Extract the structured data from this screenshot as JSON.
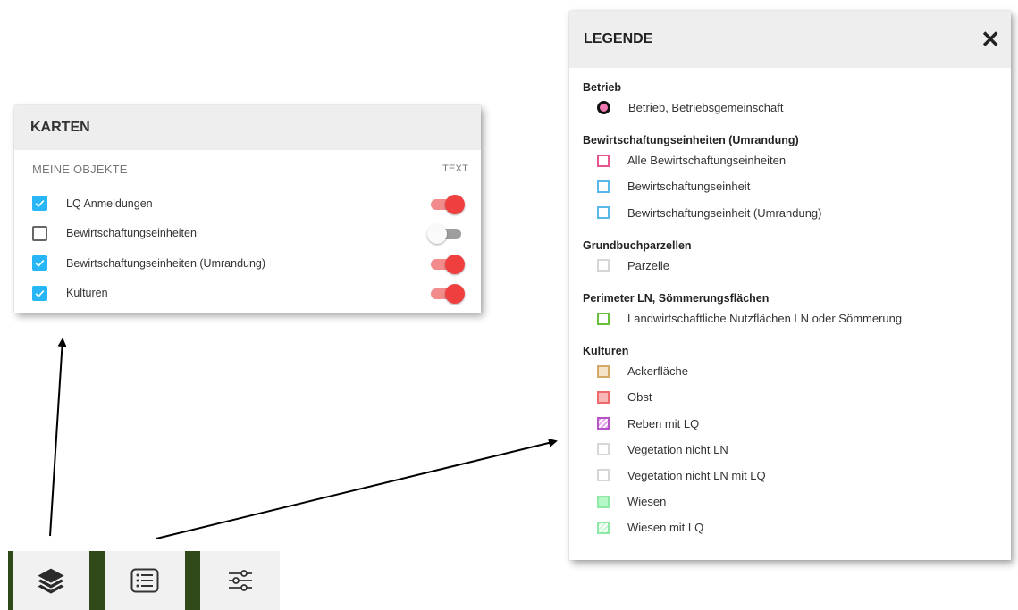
{
  "karten": {
    "title": "KARTEN",
    "section_label": "MEINE OBJEKTE",
    "text_label": "TEXT",
    "layers": [
      {
        "label": "LQ Anmeldungen",
        "checked": true,
        "text_on": true
      },
      {
        "label": "Bewirtschaftungseinheiten",
        "checked": false,
        "text_on": false
      },
      {
        "label": "Bewirtschaftungseinheiten (Umrandung)",
        "checked": true,
        "text_on": true
      },
      {
        "label": "Kulturen",
        "checked": true,
        "text_on": true
      }
    ]
  },
  "legende": {
    "title": "LEGENDE",
    "close_glyph": "✕",
    "groups": [
      {
        "title": "Betrieb",
        "items": [
          {
            "label": "Betrieb, Betriebsgemeinschaft",
            "symbol": "circle",
            "fill": "#ee79b0",
            "border": "#111111"
          }
        ]
      },
      {
        "title": "Bewirtschaftungseinheiten (Umrandung)",
        "items": [
          {
            "label": "Alle Bewirtschaftungseinheiten",
            "symbol": "outline",
            "border": "#e8548e"
          },
          {
            "label": "Bewirtschaftungseinheit",
            "symbol": "outline",
            "border": "#5ab8e8"
          },
          {
            "label": "Bewirtschaftungseinheit (Umrandung)",
            "symbol": "outline",
            "border": "#5ab8e8"
          }
        ]
      },
      {
        "title": "Grundbuchparzellen",
        "items": [
          {
            "label": "Parzelle",
            "symbol": "outline",
            "border": "#d6d6d6"
          }
        ]
      },
      {
        "title": "Perimeter LN, Sömmerungsflächen",
        "items": [
          {
            "label": "Landwirtschaftliche Nutzflächen LN oder Sömmerung",
            "symbol": "outline",
            "border": "#6abf3a"
          }
        ]
      },
      {
        "title": "Kulturen",
        "items": [
          {
            "label": "Ackerfläche",
            "symbol": "filled",
            "fill": "#f4e3c6",
            "border": "#d4a865"
          },
          {
            "label": "Obst",
            "symbol": "filled",
            "fill": "#f9b7b7",
            "border": "#ee6a6a"
          },
          {
            "label": "Reben mit LQ",
            "symbol": "hatched",
            "fill": "#e5a4ec",
            "border": "#b653c6"
          },
          {
            "label": "Vegetation nicht LN",
            "symbol": "outline",
            "border": "#d6d6d6"
          },
          {
            "label": "Vegetation nicht LN mit LQ",
            "symbol": "outline",
            "border": "#d6d6d6"
          },
          {
            "label": "Wiesen",
            "symbol": "filled",
            "fill": "#b5f7c7",
            "border": "#8ee8a6"
          },
          {
            "label": "Wiesen mit LQ",
            "symbol": "hatched",
            "fill": "#c7f9d3",
            "border": "#8ee8a6"
          }
        ]
      }
    ]
  },
  "toolbar": {
    "buttons": [
      {
        "icon": "layers-icon"
      },
      {
        "icon": "list-icon"
      },
      {
        "icon": "sliders-icon"
      }
    ]
  }
}
